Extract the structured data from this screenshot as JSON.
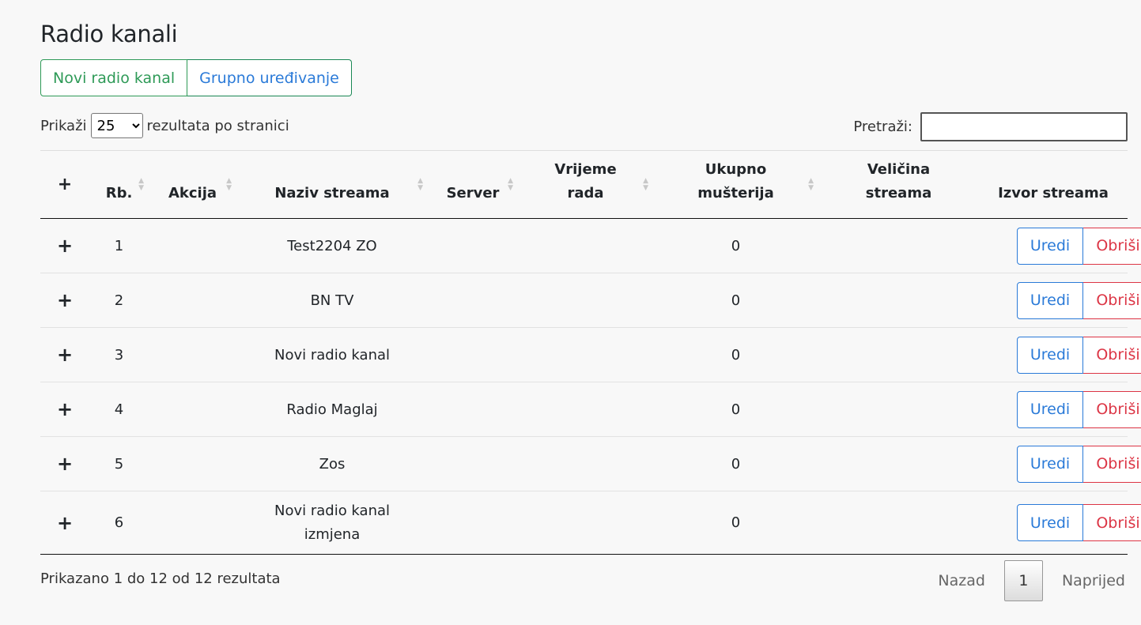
{
  "page": {
    "title": "Radio kanali"
  },
  "toolbar": {
    "new_label": "Novi radio kanal",
    "group_edit_label": "Grupno uređivanje"
  },
  "length": {
    "prefix": "Prikaži",
    "value": "25",
    "suffix": "rezultata po stranici"
  },
  "search": {
    "label": "Pretraži:",
    "value": ""
  },
  "table": {
    "headers": {
      "expand": "+",
      "rb": "Rb.",
      "akcija": "Akcija",
      "naziv": "Naziv streama",
      "server": "Server",
      "vrijeme_1": "Vrijeme",
      "vrijeme_2": "rada",
      "ukupno_1": "Ukupno",
      "ukupno_2": "mušterija",
      "velicina_1": "Veličina",
      "velicina_2": "streama",
      "izvor": "Izvor streama"
    },
    "edit_label": "Uredi",
    "delete_label": "Obriši",
    "rows": [
      {
        "rb": "1",
        "naziv": "Test2204 ZO",
        "ukupno": "0"
      },
      {
        "rb": "2",
        "naziv": "BN TV",
        "ukupno": "0"
      },
      {
        "rb": "3",
        "naziv": "Novi radio kanal",
        "ukupno": "0"
      },
      {
        "rb": "4",
        "naziv": "Radio Maglaj",
        "ukupno": "0"
      },
      {
        "rb": "5",
        "naziv": "Zos",
        "ukupno": "0"
      },
      {
        "rb": "6",
        "naziv_1": "Novi radio kanal",
        "naziv_2": "izmjena",
        "ukupno": "0"
      }
    ]
  },
  "footer": {
    "info": "Prikazano 1 do 12 od 12 rezultata",
    "prev": "Nazad",
    "page": "1",
    "next": "Naprijed"
  }
}
